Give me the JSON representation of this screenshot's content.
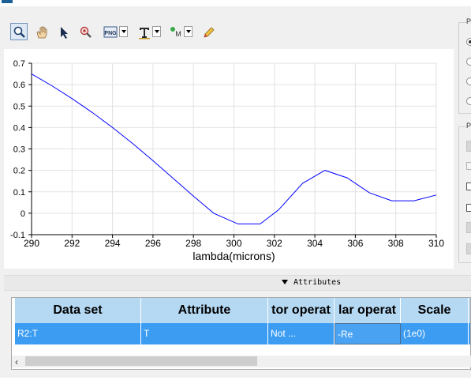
{
  "toolbar": {
    "buttons": [
      "zoom",
      "pan",
      "select",
      "zoom-region",
      "export-png",
      "text-annotation",
      "marker",
      "draw"
    ],
    "export_label": "PNG",
    "marker_label": "M"
  },
  "chart_data": {
    "type": "line",
    "xlabel": "lambda(microns)",
    "ylabel": "",
    "xlim": [
      290,
      310
    ],
    "ylim": [
      -0.1,
      0.7
    ],
    "x_ticks": [
      "290",
      "292",
      "294",
      "296",
      "298",
      "300",
      "302",
      "304",
      "306",
      "308",
      "310"
    ],
    "y_ticks": [
      "-0.1",
      "0",
      "0.1",
      "0.2",
      "0.3",
      "0.4",
      "0.5",
      "0.6",
      "0.7"
    ],
    "grid": true,
    "series": [
      {
        "color": "#0000ff",
        "x": [
          290,
          291,
          292,
          293,
          294,
          295,
          296,
          297,
          298,
          299,
          300.2,
          301.3,
          302.2,
          303.4,
          304.5,
          305.6,
          306.7,
          307.8,
          308.9,
          310
        ],
        "y": [
          0.65,
          0.595,
          0.535,
          0.47,
          0.4,
          0.325,
          0.245,
          0.163,
          0.08,
          0.0,
          -0.05,
          -0.05,
          0.015,
          0.14,
          0.2,
          0.165,
          0.095,
          0.058,
          0.058,
          0.085
        ]
      }
    ]
  },
  "right_panel": {
    "group1_label": "P",
    "group2_label": "P"
  },
  "attributes_section": {
    "title": "Attributes"
  },
  "table": {
    "columns": [
      "Data set",
      "Attribute",
      "tor operat",
      "lar operat",
      "Scale"
    ],
    "rows": [
      [
        "R2:T",
        "T",
        "Not ...",
        "-Re",
        "(1e0)"
      ]
    ]
  },
  "scrollbar": {
    "left_arrow": "‹"
  }
}
